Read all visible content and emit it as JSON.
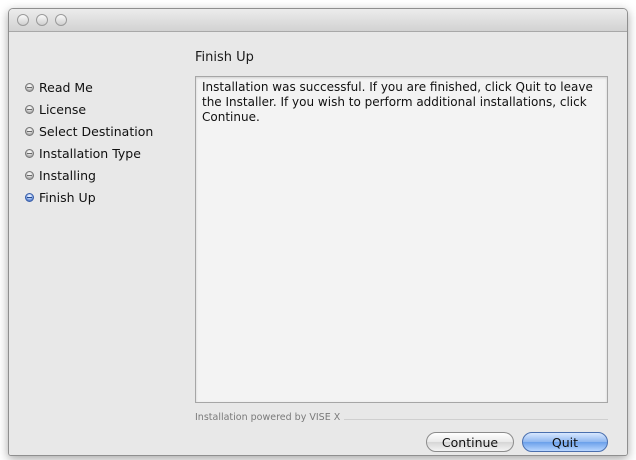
{
  "window": {
    "title": ""
  },
  "installer": {
    "section_title": "Finish Up",
    "steps": [
      {
        "label": "Read Me",
        "active": false
      },
      {
        "label": "License",
        "active": false
      },
      {
        "label": "Select Destination",
        "active": false
      },
      {
        "label": "Installation Type",
        "active": false
      },
      {
        "label": "Installing",
        "active": false
      },
      {
        "label": "Finish Up",
        "active": true
      }
    ],
    "message": "Installation was successful. If you are finished, click Quit to leave the Installer. If you wish to perform additional installations, click Continue.",
    "powered_by": "Installation powered by VISE X"
  },
  "buttons": {
    "continue_label": "Continue",
    "quit_label": "Quit"
  },
  "icons": {
    "step_bullet": "step-bullet-icon",
    "active_step_bullet": "active-step-bullet-icon"
  },
  "colors": {
    "active_bullet": "#3a5fa8",
    "default_button": "#6aa0ea"
  }
}
